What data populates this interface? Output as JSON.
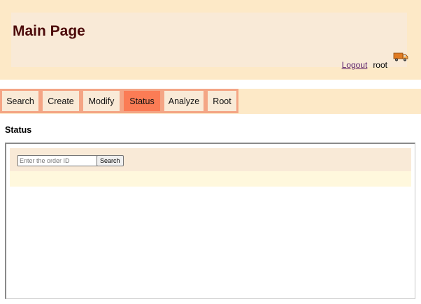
{
  "header": {
    "title": "Main Page",
    "logout_label": "Logout",
    "username": "root",
    "user_icon": "truck-icon"
  },
  "nav": {
    "active": "Status",
    "tabs": [
      {
        "label": "Search"
      },
      {
        "label": "Create"
      },
      {
        "label": "Modify"
      },
      {
        "label": "Status"
      },
      {
        "label": "Analyze"
      },
      {
        "label": "Root"
      }
    ]
  },
  "section": {
    "heading": "Status"
  },
  "status_search": {
    "placeholder": "Enter the order ID",
    "value": "",
    "button_label": "Search"
  },
  "colors": {
    "banner": "#fde9c7",
    "header_box": "#f9ead7",
    "title": "#4c0a0a",
    "tab_border": "#f4a585",
    "tab_active": "#fb7c55",
    "result_area": "#fff8dd"
  }
}
